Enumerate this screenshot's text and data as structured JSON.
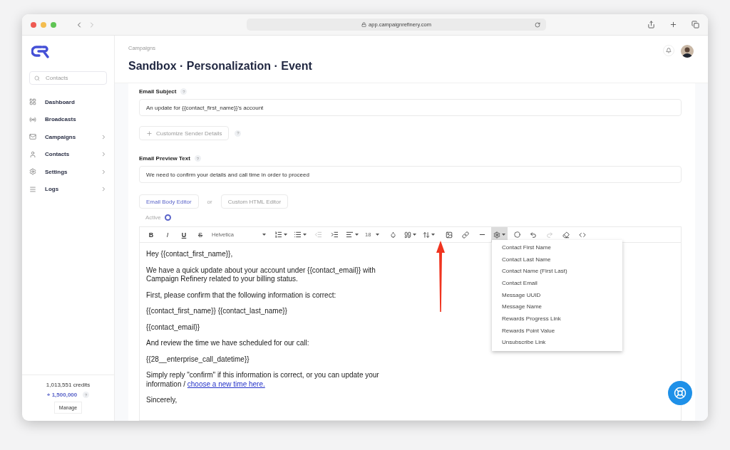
{
  "browser": {
    "url": "app.campaignrefinery.com"
  },
  "sidebar": {
    "search": {
      "placeholder": "Contacts"
    },
    "items": [
      {
        "label": "Dashboard",
        "expandable": false
      },
      {
        "label": "Broadcasts",
        "expandable": false
      },
      {
        "label": "Campaigns",
        "expandable": true
      },
      {
        "label": "Contacts",
        "expandable": true
      },
      {
        "label": "Settings",
        "expandable": true
      },
      {
        "label": "Logs",
        "expandable": true
      }
    ],
    "credits": "1,013,551 credits",
    "bonus": "+ 1,500,000",
    "bonus_help": "?",
    "manage": "Manage"
  },
  "header": {
    "breadcrumb": "Campaigns",
    "title": "Sandbox · Personalization · Event"
  },
  "form": {
    "subject": {
      "label": "Email Subject",
      "help": "?",
      "value": "An update for {{contact_first_name}}'s account"
    },
    "sender_button": "Customize Sender Details",
    "sender_help": "?",
    "preview": {
      "label": "Email Preview Text",
      "help": "?",
      "value": "We need to confirm your details and call time in order to proceed"
    },
    "editor_tabs": [
      {
        "label": "Email Body Editor",
        "selected": true
      },
      {
        "label": "Custom HTML Editor",
        "selected": false
      }
    ],
    "or": "or",
    "active": {
      "label": "Active",
      "on": true
    }
  },
  "toolbar": {
    "format": [
      "B",
      "I",
      "U",
      "S"
    ],
    "font": "Helvetica",
    "size": "18",
    "variables_expanded": true,
    "redo_disabled": true
  },
  "variables_menu": [
    "Contact First Name",
    "Contact Last Name",
    "Contact Name (First Last)",
    "Contact Email",
    "Message UUID",
    "Message Name",
    "Rewards Progress Link",
    "Rewards Point Value",
    "Unsubscribe Link"
  ],
  "body": [
    {
      "lines": [
        "Hey {{contact_first_name}},"
      ]
    },
    {
      "lines": [
        "We have a quick update about your account under {{contact_email}} with",
        "Campaign Refinery related to your billing status."
      ]
    },
    {
      "lines": [
        "First, please confirm that the following information is correct:"
      ]
    },
    {
      "lines": [
        "{{contact_first_name}} {{contact_last_name}}"
      ]
    },
    {
      "lines": [
        "{{contact_email}}"
      ]
    },
    {
      "lines": [
        "And review the time we have scheduled for our call:"
      ]
    },
    {
      "lines": [
        "{{28__enterprise_call_datetime}}"
      ]
    },
    {
      "lines": [
        "Simply reply \"confirm\" if this information is correct, or you can update your",
        "information / "
      ],
      "link": "choose a new time here."
    },
    {
      "lines": [
        "Sincerely,"
      ]
    }
  ]
}
